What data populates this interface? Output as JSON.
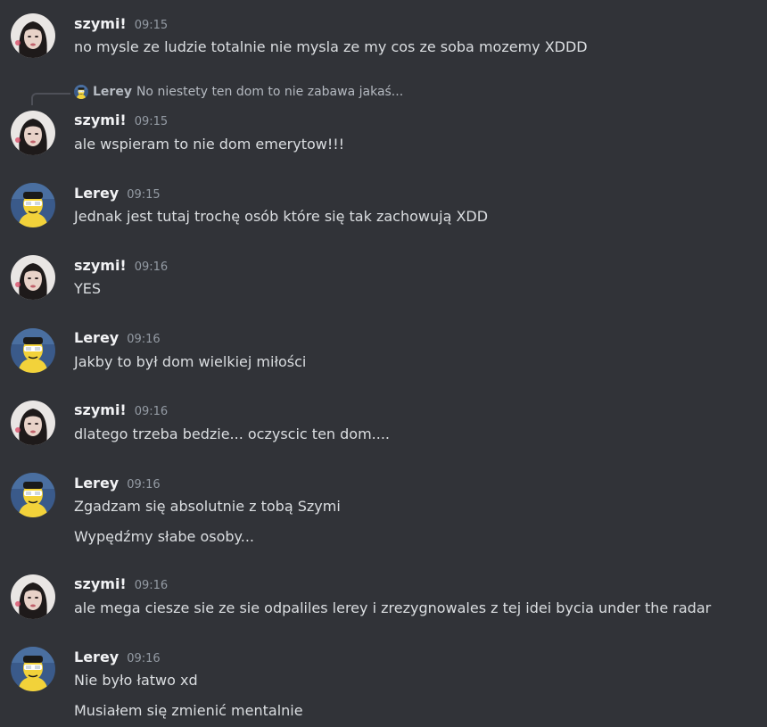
{
  "colors": {
    "background": "#313338",
    "username": "#f2f3f5",
    "text": "#dbdee1",
    "timestamp": "#949ba4"
  },
  "reply": {
    "username": "Lerey",
    "text": "No niestety ten dom to nie zabawa jakaś...",
    "avatar_icon": "lerey-avatar-icon"
  },
  "messages": [
    {
      "user": "szymi!",
      "time": "09:15",
      "avatar_icon": "szymi-avatar-icon",
      "lines": [
        "no mysle ze ludzie totalnie nie mysla ze my cos ze soba mozemy XDDD"
      ]
    },
    {
      "user": "szymi!",
      "time": "09:15",
      "avatar_icon": "szymi-avatar-icon",
      "lines": [
        "ale wspieram to nie dom emerytow!!!"
      ]
    },
    {
      "user": "Lerey",
      "time": "09:15",
      "avatar_icon": "lerey-avatar-icon",
      "lines": [
        "Jednak jest tutaj trochę osób które się tak zachowują XDD"
      ]
    },
    {
      "user": "szymi!",
      "time": "09:16",
      "avatar_icon": "szymi-avatar-icon",
      "lines": [
        "YES"
      ]
    },
    {
      "user": "Lerey",
      "time": "09:16",
      "avatar_icon": "lerey-avatar-icon",
      "lines": [
        "Jakby to był dom wielkiej miłości"
      ]
    },
    {
      "user": "szymi!",
      "time": "09:16",
      "avatar_icon": "szymi-avatar-icon",
      "lines": [
        "dlatego trzeba bedzie... oczyscic ten dom...."
      ]
    },
    {
      "user": "Lerey",
      "time": "09:16",
      "avatar_icon": "lerey-avatar-icon",
      "lines": [
        "Zgadzam się absolutnie z tobą Szymi",
        "Wypędźmy słabe osoby..."
      ]
    },
    {
      "user": "szymi!",
      "time": "09:16",
      "avatar_icon": "szymi-avatar-icon",
      "lines": [
        "ale mega ciesze sie ze sie odpaliles lerey i zrezygnowales z tej idei bycia under the radar"
      ]
    },
    {
      "user": "Lerey",
      "time": "09:16",
      "avatar_icon": "lerey-avatar-icon",
      "lines": [
        "Nie było łatwo xd",
        "Musiałem się zmienić mentalnie"
      ]
    }
  ]
}
